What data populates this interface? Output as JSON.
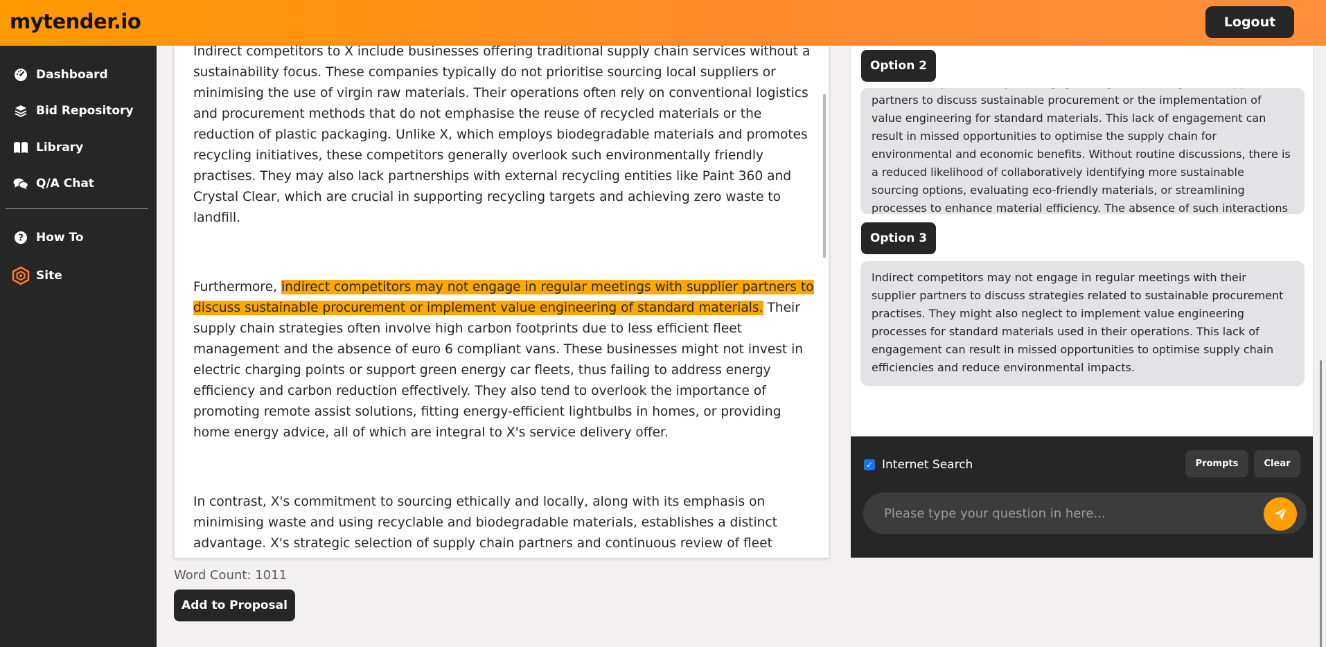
{
  "header": {
    "logo": "mytender.io",
    "logout_label": "Logout"
  },
  "sidebar": {
    "items": [
      {
        "label": "Dashboard",
        "icon": "dashboard-gauge-icon"
      },
      {
        "label": "Bid Repository",
        "icon": "layers-icon"
      },
      {
        "label": "Library",
        "icon": "book-open-icon"
      },
      {
        "label": "Q/A Chat",
        "icon": "chat-bubbles-icon"
      },
      {
        "label": "How To",
        "icon": "question-circle-icon"
      },
      {
        "label": "Site",
        "icon": "hexagon-logo-icon"
      }
    ]
  },
  "editor": {
    "p1": "Indirect competitors to X include businesses offering traditional supply chain services without a sustainability focus. These companies typically do not prioritise sourcing local suppliers or minimising the use of virgin raw materials. Their operations often rely on conventional logistics and procurement methods that do not emphasise the reuse of recycled materials or the reduction of plastic packaging. Unlike X, which employs biodegradable materials and promotes recycling initiatives, these competitors generally overlook such environmentally friendly practises. They may also lack partnerships with external recycling entities like Paint 360 and Crystal Clear, which are crucial in supporting recycling targets and achieving zero waste to landfill.",
    "p2_before": "Furthermore, ",
    "p2_highlight": "indirect competitors may not engage in regular meetings with supplier partners to discuss sustainable procurement or implement value engineering of standard materials.",
    "p2_after": " Their supply chain strategies often involve high carbon footprints due to less efficient fleet management and the absence of euro 6 compliant vans. These businesses might not invest in electric charging points or support green energy car fleets, thus failing to address energy efficiency and carbon reduction effectively. They also tend to overlook the importance of promoting remote assist solutions, fitting energy-efficient lightbulbs in homes, or providing home energy advice, all of which are integral to X's service delivery offer.",
    "p3": "In contrast, X's commitment to sourcing ethically and locally, along with its emphasis on minimising waste and using recyclable and biodegradable materials, establishes a distinct advantage. X's strategic selection of supply chain partners and continuous review of fleet"
  },
  "footer": {
    "word_count": "Word Count: 1011",
    "add_label": "Add to Proposal"
  },
  "chat": {
    "options": [
      {
        "label": "Option 2",
        "text": "Indirect competitors may not engage in regular meetings with supplier partners to discuss sustainable procurement or the implementation of value engineering for standard materials. This lack of engagement can result in missed opportunities to optimise the supply chain for environmental and economic benefits. Without routine discussions, there is a reduced likelihood of collaboratively identifying more sustainable sourcing options, evaluating eco-friendly materials, or streamlining processes to enhance material efficiency. The absence of such interactions also means that indirect competitors may not stay"
      },
      {
        "label": "Option 3",
        "text": "Indirect competitors may not engage in regular meetings with their supplier partners to discuss strategies related to sustainable procurement practises. They might also neglect to implement value engineering processes for standard materials used in their operations. This lack of engagement can result in missed opportunities to optimise supply chain efficiencies and reduce environmental impacts."
      }
    ],
    "internet_search_label": "Internet Search",
    "internet_search_checked": true,
    "prompts_label": "Prompts",
    "clear_label": "Clear",
    "input_placeholder": "Please type your question in here..."
  },
  "colors": {
    "accent": "#ffa000",
    "dark": "#262626",
    "highlight": "#ffa800",
    "checkbox": "#1a73e8"
  }
}
